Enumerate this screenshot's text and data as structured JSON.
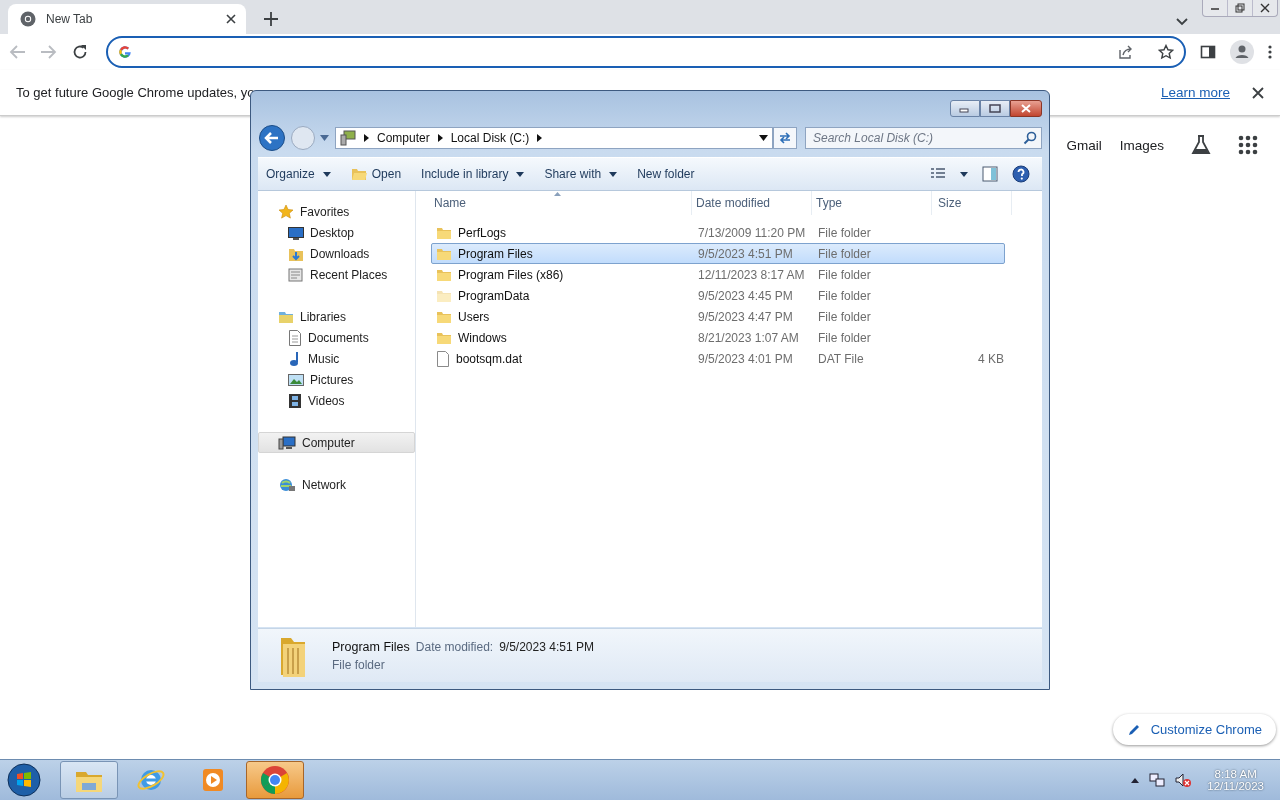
{
  "browser": {
    "tab": {
      "title": "New Tab",
      "selected": true
    },
    "infobar": {
      "message": "To get future Google Chrome updates, yo",
      "link": "Learn more"
    },
    "ntp_links": [
      "Gmail",
      "Images"
    ],
    "customize_button": "Customize Chrome"
  },
  "explorer": {
    "breadcrumbs": [
      "Computer",
      "Local Disk (C:)"
    ],
    "search_placeholder": "Search Local Disk (C:)",
    "commands": [
      {
        "label": "Organize",
        "dropdown": true,
        "kind": "text"
      },
      {
        "label": "Open",
        "dropdown": false,
        "kind": "open"
      },
      {
        "label": "Include in library",
        "dropdown": true,
        "kind": "text"
      },
      {
        "label": "Share with",
        "dropdown": true,
        "kind": "text"
      },
      {
        "label": "New folder",
        "dropdown": false,
        "kind": "text"
      }
    ],
    "nav": [
      {
        "label": "Favorites",
        "kind": "star",
        "selected": false,
        "children": [
          {
            "label": "Desktop",
            "kind": "desktop",
            "selected": false
          },
          {
            "label": "Downloads",
            "kind": "downloads",
            "selected": false
          },
          {
            "label": "Recent Places",
            "kind": "recent",
            "selected": false
          }
        ]
      },
      {
        "label": "Libraries",
        "kind": "library",
        "selected": false,
        "children": [
          {
            "label": "Documents",
            "kind": "documents",
            "selected": false
          },
          {
            "label": "Music",
            "kind": "music",
            "selected": false
          },
          {
            "label": "Pictures",
            "kind": "pictures",
            "selected": false
          },
          {
            "label": "Videos",
            "kind": "videos",
            "selected": false
          }
        ]
      },
      {
        "label": "Computer",
        "kind": "computer",
        "selected": true
      },
      {
        "label": "Network",
        "kind": "network",
        "selected": false
      }
    ],
    "columns": [
      {
        "label": "Name",
        "sorted": true
      },
      {
        "label": "Date modified",
        "sorted": false
      },
      {
        "label": "Type",
        "sorted": false
      },
      {
        "label": "Size",
        "sorted": false
      }
    ],
    "rows": [
      {
        "name": "PerfLogs",
        "date": "7/13/2009 11:20 PM",
        "type": "File folder",
        "kind": "folder",
        "hidden": false,
        "selected": false
      },
      {
        "name": "Program Files",
        "date": "9/5/2023 4:51 PM",
        "type": "File folder",
        "kind": "folder",
        "hidden": false,
        "selected": true
      },
      {
        "name": "Program Files (x86)",
        "date": "12/11/2023 8:17 AM",
        "type": "File folder",
        "kind": "folder",
        "hidden": false,
        "selected": false
      },
      {
        "name": "ProgramData",
        "date": "9/5/2023 4:45 PM",
        "type": "File folder",
        "kind": "folder",
        "hidden": true,
        "selected": false
      },
      {
        "name": "Users",
        "date": "9/5/2023 4:47 PM",
        "type": "File folder",
        "kind": "folder",
        "hidden": false,
        "selected": false
      },
      {
        "name": "Windows",
        "date": "8/21/2023 1:07 AM",
        "type": "File folder",
        "kind": "folder",
        "hidden": false,
        "selected": false
      },
      {
        "name": "bootsqm.dat",
        "date": "9/5/2023 4:01 PM",
        "type": "DAT File",
        "size": "4 KB",
        "kind": "file",
        "hidden": false,
        "selected": false
      }
    ],
    "details": {
      "name": "Program Files",
      "date_label": "Date modified:",
      "date": "9/5/2023 4:51 PM",
      "type": "File folder"
    }
  },
  "taskbar": {
    "apps": [
      {
        "kind": "explorer",
        "running": true,
        "selected": false
      },
      {
        "kind": "ie",
        "running": false,
        "selected": false
      },
      {
        "kind": "media",
        "running": false,
        "selected": false
      },
      {
        "kind": "chrome",
        "running": true,
        "selected": true
      }
    ],
    "clock": {
      "time": "8:18 AM",
      "date": "12/11/2023"
    }
  }
}
